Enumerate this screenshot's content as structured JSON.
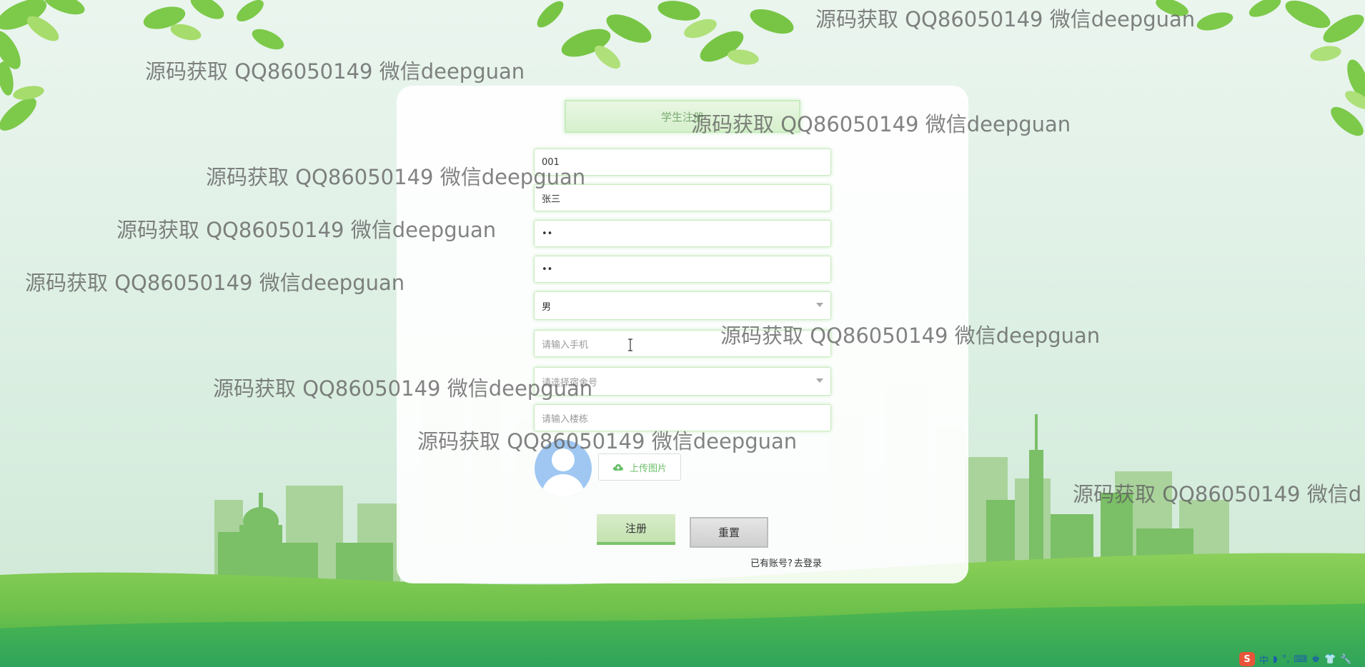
{
  "form": {
    "title": "学生注册",
    "fields": [
      {
        "name": "student-id-input",
        "value": "001",
        "placeholder": "",
        "type": "text"
      },
      {
        "name": "student-name-input",
        "value": "张三",
        "placeholder": "",
        "type": "text"
      },
      {
        "name": "password-input",
        "value": "••",
        "placeholder": "",
        "type": "password"
      },
      {
        "name": "confirm-password-input",
        "value": "••",
        "placeholder": "",
        "type": "password"
      },
      {
        "name": "gender-select",
        "value": "男",
        "placeholder": "",
        "type": "select"
      },
      {
        "name": "phone-input",
        "value": "",
        "placeholder": "请输入手机",
        "type": "text"
      },
      {
        "name": "dorm-number-select",
        "value": "",
        "placeholder": "请选择宿舍号",
        "type": "select"
      },
      {
        "name": "building-input",
        "value": "",
        "placeholder": "请输入楼栋",
        "type": "text"
      }
    ],
    "upload_label": "上传图片",
    "register_label": "注册",
    "reset_label": "重置",
    "has_account_text": "已有账号?",
    "login_link": "去登录"
  },
  "watermark_text": "源码获取 QQ86050149 微信deepguan",
  "watermark_text_cut": "源码获取 QQ86050149 微信d",
  "tray": {
    "ime_logo": "S",
    "symbols": [
      "中",
      "◗",
      "°,",
      "⌨",
      "♚",
      "👕",
      "🔧"
    ]
  },
  "colors": {
    "accent_green": "#7cc36a",
    "title_text": "#7aaa72",
    "avatar_blue": "#9fc7f2",
    "placeholder": "#9a9a9a"
  }
}
